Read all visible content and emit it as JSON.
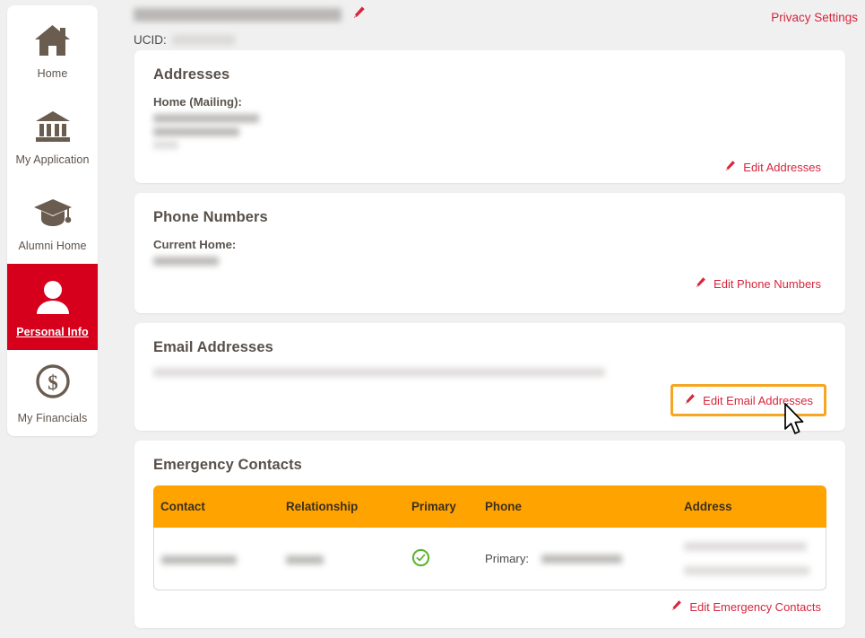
{
  "header": {
    "user_name": "",
    "ucid_label": "UCID:",
    "ucid_value": "",
    "edit_name_icon": "pencil-icon",
    "privacy_settings_label": "Privacy Settings"
  },
  "cards": {
    "addresses": {
      "title": "Addresses",
      "sublabel": "Home (Mailing):",
      "value_lines": [
        "",
        "",
        ""
      ],
      "edit_label": "Edit Addresses",
      "edit_icon": "pencil-icon"
    },
    "phones": {
      "title": "Phone Numbers",
      "sublabel": "Current Home:",
      "value_lines": [
        ""
      ],
      "edit_label": "Edit Phone Numbers",
      "edit_icon": "pencil-icon"
    },
    "emails": {
      "title": "Email Addresses",
      "message": "",
      "edit_label": "Edit Email Addresses",
      "edit_icon": "pencil-icon",
      "highlighted": true
    },
    "emergency": {
      "title": "Emergency Contacts",
      "columns": [
        "Contact",
        "Relationship",
        "Primary",
        "Phone",
        "Address"
      ],
      "rows": [
        {
          "contact": "",
          "relationship": "",
          "primary_icon": "check-circle-icon",
          "phone_tag": "Primary:",
          "phone_value": "",
          "address_lines": [
            "",
            ""
          ]
        }
      ],
      "edit_label": "Edit Emergency Contacts",
      "edit_icon": "pencil-icon"
    }
  },
  "sidebar": {
    "items": [
      {
        "label": "Home",
        "icon": "house-icon",
        "active": false
      },
      {
        "label": "My Application",
        "icon": "bank-building-icon",
        "active": false
      },
      {
        "label": "Alumni Home",
        "icon": "graduation-cap-icon",
        "active": false
      },
      {
        "label": "Personal Info",
        "icon": "person-icon",
        "active": true
      },
      {
        "label": "My Financials",
        "icon": "dollar-circle-icon",
        "active": false
      }
    ]
  },
  "colors": {
    "brand_red": "#d6001c",
    "link_red": "#d6263c",
    "table_header_orange": "#ffa300",
    "highlight_orange": "#f5a623",
    "icon_brown": "#6b5c50",
    "check_green": "#5cb531",
    "page_bg": "#f0f0f0"
  }
}
